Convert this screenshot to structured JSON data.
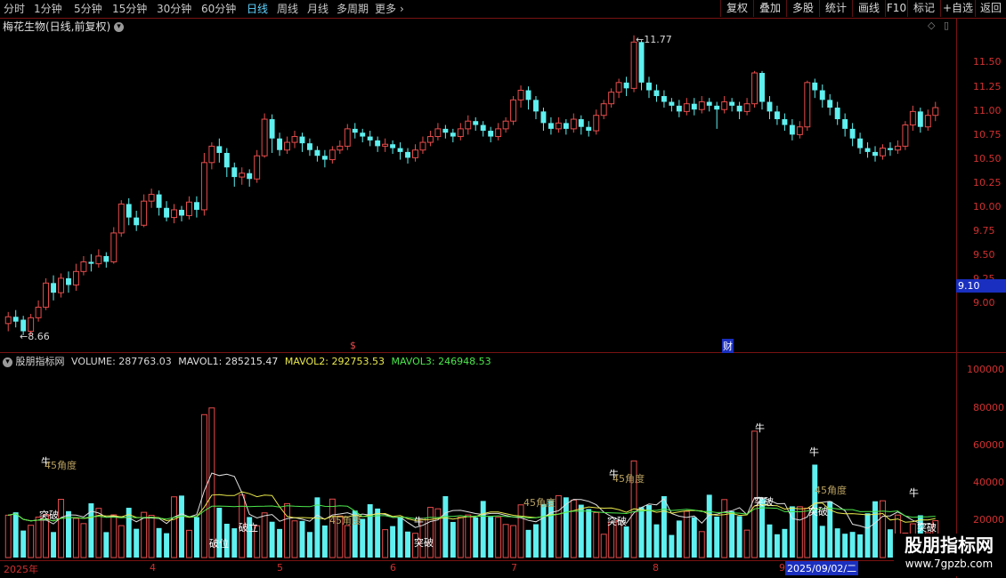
{
  "toolbar": {
    "periods": [
      "分时",
      "1分钟",
      "5分钟",
      "15分钟",
      "30分钟",
      "60分钟",
      "日线",
      "周线",
      "月线",
      "多周期",
      "更多"
    ],
    "active_period": "日线",
    "more_chevron": "›",
    "right_buttons": [
      "复权",
      "叠加",
      "多股",
      "统计",
      "画线",
      "F10",
      "+自选",
      "返回"
    ]
  },
  "chart_title": "梅花生物(日线,前复权)",
  "title_icons": {
    "left": "chevron-down-icon",
    "diamond": "diamond-icon",
    "panel": "panel-toggle-icon"
  },
  "price_axis": [
    "11.50",
    "11.25",
    "11.00",
    "10.75",
    "10.50",
    "10.25",
    "10.00",
    "9.75",
    "9.50",
    "9.25",
    "9.00"
  ],
  "current_price": "9.10",
  "current_price_color": "#1a2fbf",
  "high_label": "11.77",
  "low_label": "8.66",
  "markers": {
    "dividend": "$",
    "finance": "财"
  },
  "indicator": {
    "name": "股朋指标网",
    "volume": "VOLUME: 287763.03",
    "mavol1": "MAVOL1: 285215.47",
    "mavol2": "MAVOL2: 292753.53",
    "mavol3": "MAVOL3: 246948.53"
  },
  "volume_axis": [
    "100000",
    "80000",
    "60000",
    "40000",
    "20000"
  ],
  "date_axis": [
    "2025年",
    "4",
    "5",
    "6",
    "7",
    "8",
    "9"
  ],
  "cursor_date": "2025/09/02/二",
  "annotations": {
    "niu": "牛",
    "tupo": "突破",
    "angle45": "45角度",
    "poli": "破位",
    "pozhi": "破立"
  },
  "watermark": "股朋指标网",
  "watermark_url": "www.7gpzb.com",
  "colors": {
    "up": "#e84c4c",
    "down": "#5ff0f0",
    "frame": "#7a1212",
    "accent": "#5fd3ff"
  },
  "chart_data": {
    "type": "candlestick",
    "title": "梅花生物(日线,前复权)",
    "y_range": [
      8.5,
      11.9
    ],
    "candles": [
      [
        8.78,
        8.85,
        8.7,
        8.9
      ],
      [
        8.85,
        8.8,
        8.74,
        8.92
      ],
      [
        8.82,
        8.7,
        8.66,
        8.86
      ],
      [
        8.7,
        8.84,
        8.66,
        8.88
      ],
      [
        8.84,
        8.95,
        8.8,
        9.02
      ],
      [
        8.95,
        9.2,
        8.92,
        9.25
      ],
      [
        9.2,
        9.1,
        9.02,
        9.28
      ],
      [
        9.1,
        9.25,
        9.05,
        9.3
      ],
      [
        9.25,
        9.18,
        9.1,
        9.32
      ],
      [
        9.18,
        9.32,
        9.12,
        9.4
      ],
      [
        9.32,
        9.42,
        9.28,
        9.48
      ],
      [
        9.42,
        9.4,
        9.32,
        9.5
      ],
      [
        9.4,
        9.48,
        9.36,
        9.55
      ],
      [
        9.48,
        9.42,
        9.36,
        9.52
      ],
      [
        9.42,
        9.72,
        9.4,
        9.78
      ],
      [
        9.72,
        10.02,
        9.68,
        10.06
      ],
      [
        10.02,
        9.88,
        9.8,
        10.08
      ],
      [
        9.88,
        9.8,
        9.74,
        9.95
      ],
      [
        9.8,
        10.05,
        9.78,
        10.12
      ],
      [
        10.05,
        10.12,
        9.98,
        10.18
      ],
      [
        10.12,
        9.98,
        9.9,
        10.16
      ],
      [
        9.98,
        9.88,
        9.84,
        10.05
      ],
      [
        9.88,
        9.96,
        9.82,
        10.02
      ],
      [
        9.96,
        9.9,
        9.84,
        10.0
      ],
      [
        9.9,
        10.04,
        9.86,
        10.1
      ],
      [
        10.04,
        9.96,
        9.88,
        10.1
      ],
      [
        9.96,
        10.45,
        9.9,
        10.55
      ],
      [
        10.45,
        10.62,
        10.38,
        10.66
      ],
      [
        10.62,
        10.55,
        10.45,
        10.7
      ],
      [
        10.55,
        10.4,
        10.3,
        10.6
      ],
      [
        10.4,
        10.3,
        10.2,
        10.45
      ],
      [
        10.3,
        10.34,
        10.22,
        10.4
      ],
      [
        10.34,
        10.28,
        10.2,
        10.38
      ],
      [
        10.28,
        10.52,
        10.24,
        10.58
      ],
      [
        10.52,
        10.9,
        10.5,
        10.96
      ],
      [
        10.9,
        10.7,
        10.55,
        10.95
      ],
      [
        10.7,
        10.58,
        10.52,
        10.76
      ],
      [
        10.58,
        10.66,
        10.54,
        10.72
      ],
      [
        10.66,
        10.72,
        10.6,
        10.78
      ],
      [
        10.72,
        10.65,
        10.56,
        10.76
      ],
      [
        10.65,
        10.58,
        10.52,
        10.7
      ],
      [
        10.58,
        10.52,
        10.46,
        10.62
      ],
      [
        10.52,
        10.48,
        10.4,
        10.58
      ],
      [
        10.48,
        10.58,
        10.44,
        10.62
      ],
      [
        10.58,
        10.62,
        10.54,
        10.68
      ],
      [
        10.62,
        10.8,
        10.58,
        10.85
      ],
      [
        10.8,
        10.76,
        10.7,
        10.86
      ],
      [
        10.76,
        10.72,
        10.66,
        10.8
      ],
      [
        10.72,
        10.68,
        10.62,
        10.78
      ],
      [
        10.68,
        10.62,
        10.56,
        10.72
      ],
      [
        10.62,
        10.64,
        10.56,
        10.7
      ],
      [
        10.64,
        10.6,
        10.54,
        10.68
      ],
      [
        10.6,
        10.56,
        10.48,
        10.66
      ],
      [
        10.56,
        10.5,
        10.44,
        10.6
      ],
      [
        10.5,
        10.58,
        10.46,
        10.64
      ],
      [
        10.58,
        10.66,
        10.54,
        10.72
      ],
      [
        10.66,
        10.72,
        10.62,
        10.78
      ],
      [
        10.72,
        10.8,
        10.68,
        10.86
      ],
      [
        10.8,
        10.76,
        10.7,
        10.84
      ],
      [
        10.76,
        10.72,
        10.66,
        10.8
      ],
      [
        10.72,
        10.8,
        10.68,
        10.86
      ],
      [
        10.8,
        10.88,
        10.74,
        10.94
      ],
      [
        10.88,
        10.84,
        10.78,
        10.92
      ],
      [
        10.84,
        10.78,
        10.72,
        10.88
      ],
      [
        10.78,
        10.72,
        10.66,
        10.82
      ],
      [
        10.72,
        10.8,
        10.68,
        10.86
      ],
      [
        10.8,
        10.88,
        10.76,
        10.92
      ],
      [
        10.88,
        11.1,
        10.84,
        11.14
      ],
      [
        11.1,
        11.2,
        11.02,
        11.25
      ],
      [
        11.2,
        11.1,
        11.0,
        11.24
      ],
      [
        11.1,
        10.98,
        10.9,
        11.14
      ],
      [
        10.98,
        10.86,
        10.78,
        11.02
      ],
      [
        10.86,
        10.8,
        10.74,
        10.92
      ],
      [
        10.8,
        10.86,
        10.76,
        10.92
      ],
      [
        10.86,
        10.8,
        10.74,
        10.9
      ],
      [
        10.8,
        10.9,
        10.76,
        10.96
      ],
      [
        10.9,
        10.82,
        10.74,
        10.94
      ],
      [
        10.82,
        10.78,
        10.72,
        10.88
      ],
      [
        10.78,
        10.94,
        10.74,
        11.0
      ],
      [
        10.94,
        11.06,
        10.9,
        11.1
      ],
      [
        11.06,
        11.18,
        11.02,
        11.22
      ],
      [
        11.18,
        11.28,
        11.12,
        11.32
      ],
      [
        11.28,
        11.22,
        11.14,
        11.34
      ],
      [
        11.22,
        11.7,
        11.18,
        11.77
      ],
      [
        11.7,
        11.28,
        11.2,
        11.72
      ],
      [
        11.28,
        11.2,
        11.12,
        11.34
      ],
      [
        11.2,
        11.14,
        11.08,
        11.26
      ],
      [
        11.14,
        11.08,
        11.02,
        11.2
      ],
      [
        11.08,
        11.04,
        10.98,
        11.12
      ],
      [
        11.04,
        10.98,
        10.92,
        11.1
      ],
      [
        10.98,
        11.06,
        10.94,
        11.12
      ],
      [
        11.06,
        11.0,
        10.94,
        11.12
      ],
      [
        11.0,
        11.08,
        10.96,
        11.14
      ],
      [
        11.08,
        11.04,
        10.98,
        11.12
      ],
      [
        11.04,
        11.0,
        10.8,
        11.08
      ],
      [
        11.0,
        11.08,
        10.96,
        11.14
      ],
      [
        11.08,
        11.04,
        10.98,
        11.12
      ],
      [
        11.04,
        10.98,
        10.9,
        11.08
      ],
      [
        10.98,
        11.06,
        10.94,
        11.12
      ],
      [
        11.06,
        11.38,
        11.02,
        11.4
      ],
      [
        11.38,
        11.08,
        11.0,
        11.4
      ],
      [
        11.08,
        10.98,
        10.9,
        11.14
      ],
      [
        10.98,
        10.9,
        10.84,
        11.04
      ],
      [
        10.9,
        10.84,
        10.78,
        10.96
      ],
      [
        10.84,
        10.74,
        10.68,
        10.9
      ],
      [
        10.74,
        10.82,
        10.7,
        10.88
      ],
      [
        10.82,
        11.28,
        10.78,
        11.3
      ],
      [
        11.28,
        11.2,
        11.12,
        11.32
      ],
      [
        11.2,
        11.1,
        11.02,
        11.26
      ],
      [
        11.1,
        11.02,
        10.94,
        11.16
      ],
      [
        11.02,
        10.9,
        10.84,
        11.08
      ],
      [
        10.9,
        10.8,
        10.72,
        10.96
      ],
      [
        10.8,
        10.7,
        10.62,
        10.86
      ],
      [
        10.7,
        10.6,
        10.54,
        10.76
      ],
      [
        10.6,
        10.56,
        10.5,
        10.66
      ],
      [
        10.56,
        10.52,
        10.46,
        10.62
      ],
      [
        10.52,
        10.6,
        10.48,
        10.64
      ],
      [
        10.6,
        10.58,
        10.52,
        10.66
      ],
      [
        10.58,
        10.62,
        10.54,
        10.68
      ],
      [
        10.62,
        10.84,
        10.58,
        10.88
      ],
      [
        10.84,
        10.98,
        10.78,
        11.04
      ],
      [
        10.98,
        10.82,
        10.76,
        11.02
      ],
      [
        10.82,
        10.94,
        10.78,
        11.0
      ],
      [
        10.94,
        11.02,
        10.88,
        11.08
      ]
    ]
  }
}
